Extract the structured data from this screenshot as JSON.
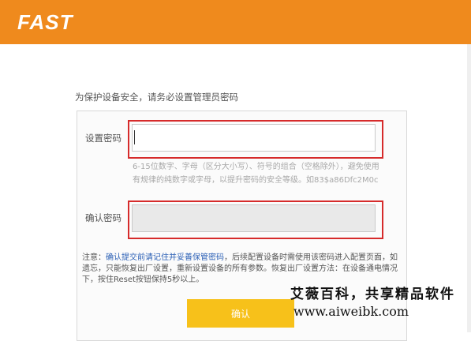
{
  "header": {
    "logo": "FAST",
    "color": "#ef8a1d"
  },
  "intro": "为保护设备安全，请务必设置管理员密码",
  "form": {
    "password_label": "设置密码",
    "password_value": "",
    "hint": "6-15位数字、字母（区分大小写）、符号的组合（空格除外），避免使用有规律的纯数字或字母，以提升密码的安全等级。如83$a86Dfc2M0c",
    "confirm_label": "确认密码",
    "confirm_value": ""
  },
  "note": {
    "prefix": "注意：",
    "link": "确认提交前请记住并妥善保管密码",
    "rest": "，后续配置设备时需使用该密码进入配置页面，如遗忘，只能恢复出厂设置，重新设置设备的所有参数。恢复出厂设置方法：在设备通电情况下，按住Reset按钮保持5秒以上。"
  },
  "confirm_button": "确认",
  "watermark": {
    "cn": "艾薇百科，共享精品软件",
    "url": "www.aiweibk.com"
  },
  "colors": {
    "highlight": "#d62b2b",
    "button": "#f7c11a",
    "link": "#2a5fb5"
  }
}
